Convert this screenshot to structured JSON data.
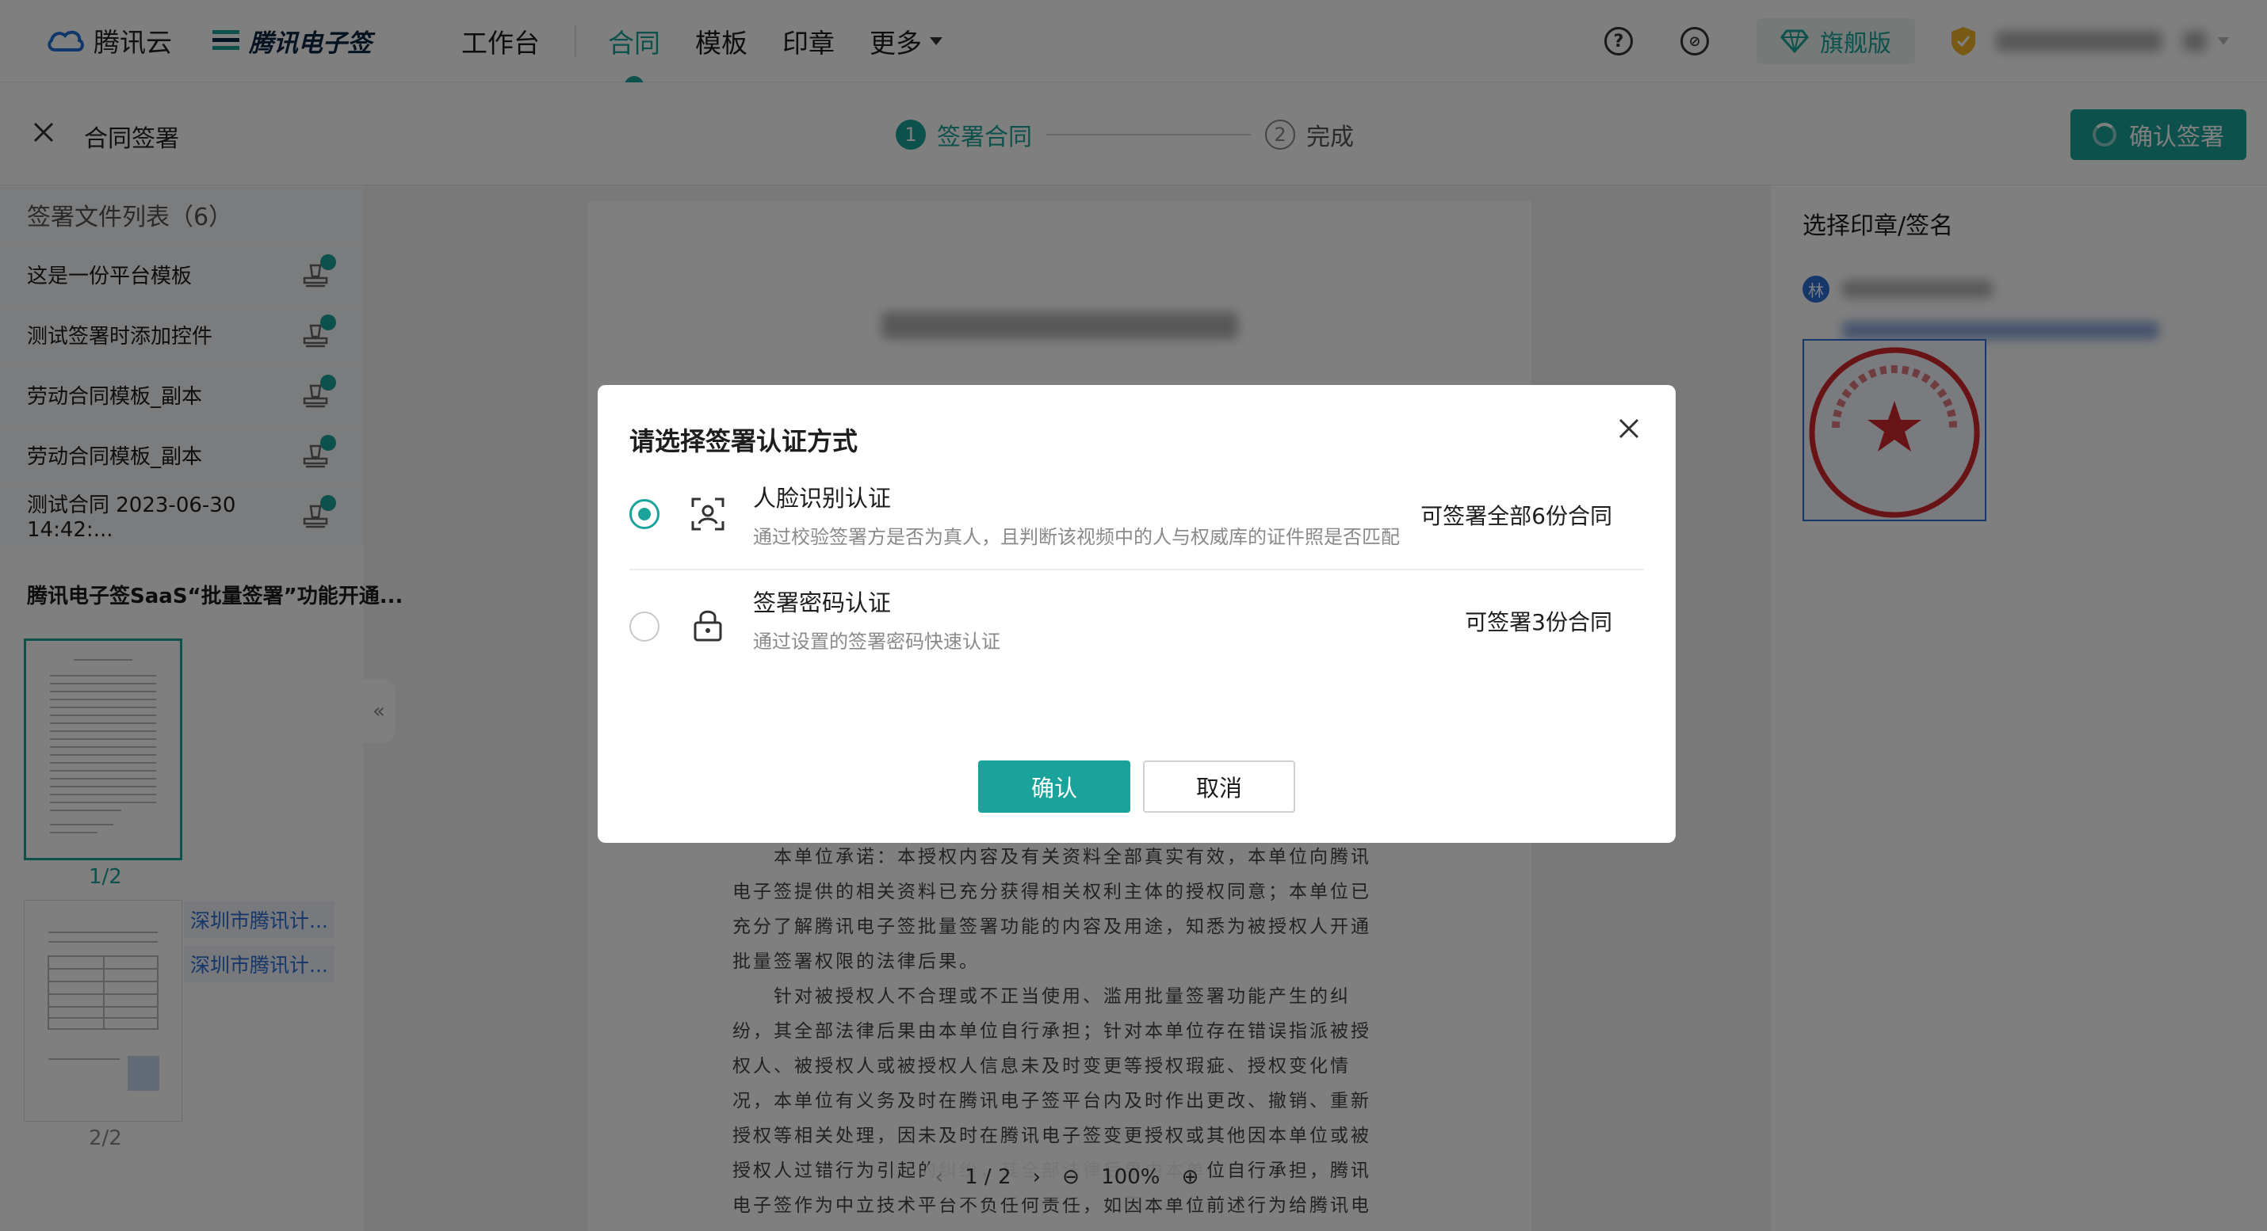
{
  "nav": {
    "brand": "腾讯云",
    "product": "腾讯电子签",
    "items": [
      {
        "label": "工作台"
      },
      {
        "label": "合同"
      },
      {
        "label": "模板"
      },
      {
        "label": "印章"
      },
      {
        "label": "更多"
      }
    ],
    "edition": "旗舰版"
  },
  "subheader": {
    "title": "合同签署",
    "steps": [
      {
        "num": "1",
        "label": "签署合同"
      },
      {
        "num": "2",
        "label": "完成"
      }
    ],
    "confirm_label": "确认签署"
  },
  "sidebar": {
    "list_title": "签署文件列表（6）",
    "files": [
      {
        "name": "这是一份平台模板"
      },
      {
        "name": "测试签署时添加控件"
      },
      {
        "name": "劳动合同模板_副本"
      },
      {
        "name": "劳动合同模板_副本"
      },
      {
        "name": "测试合同 2023-06-30 14:42:..."
      }
    ],
    "doc_title": "腾讯电子签SaaS“批量签署”功能开通...",
    "pages": [
      "1/2",
      "2/2"
    ],
    "tags": [
      "深圳市腾讯计...",
      "深圳市腾讯计..."
    ]
  },
  "right_panel": {
    "title": "选择印章/签名",
    "avatar_char": "林"
  },
  "document": {
    "paragraphs": [
      "本单位承诺：本授权内容及有关资料全部真实有效，本单位向腾讯电子签提供的相关资料已充分获得相关权利主体的授权同意；本单位已充分了解腾讯电子签批量签署功能的内容及用途，知悉为被授权人开通批量签署权限的法律后果。",
      "针对被授权人不合理或不正当使用、滥用批量签署功能产生的纠纷，其全部法律后果由本单位自行承担；针对本单位存在错误指派被授权人、被授权人或被授权人信息未及时变更等授权瑕疵、授权变化情况，本单位有义务及时在腾讯电子签平台内及时作出更改、撤销、重新授权等相关处理，因未及时在腾讯电子签变更授权或其他因本单位或被授权人过错行为引起的纠纷，其全部法律后果由本单位自行承担，腾讯电子签作为中立技术平台不负任何责任，如因本单位前述行为给腾讯电子签造成损失，腾讯电子签可以向本"
    ],
    "pager": {
      "page": "1 / 2",
      "zoom": "100%"
    }
  },
  "modal": {
    "title": "请选择签署认证方式",
    "options": [
      {
        "label": "人脸识别认证",
        "desc": "通过校验签署方是否为真人，且判断该视频中的人与权威库的证件照是否匹配",
        "right": "可签署全部6份合同",
        "selected": true
      },
      {
        "label": "签署密码认证",
        "desc": "通过设置的签署密码快速认证",
        "right": "可签署3份合同",
        "selected": false
      }
    ],
    "ok_label": "确认",
    "cancel_label": "取消"
  },
  "colors": {
    "accent": "#1aa39a",
    "link": "#2b6ed5",
    "seal": "#d0262c"
  }
}
